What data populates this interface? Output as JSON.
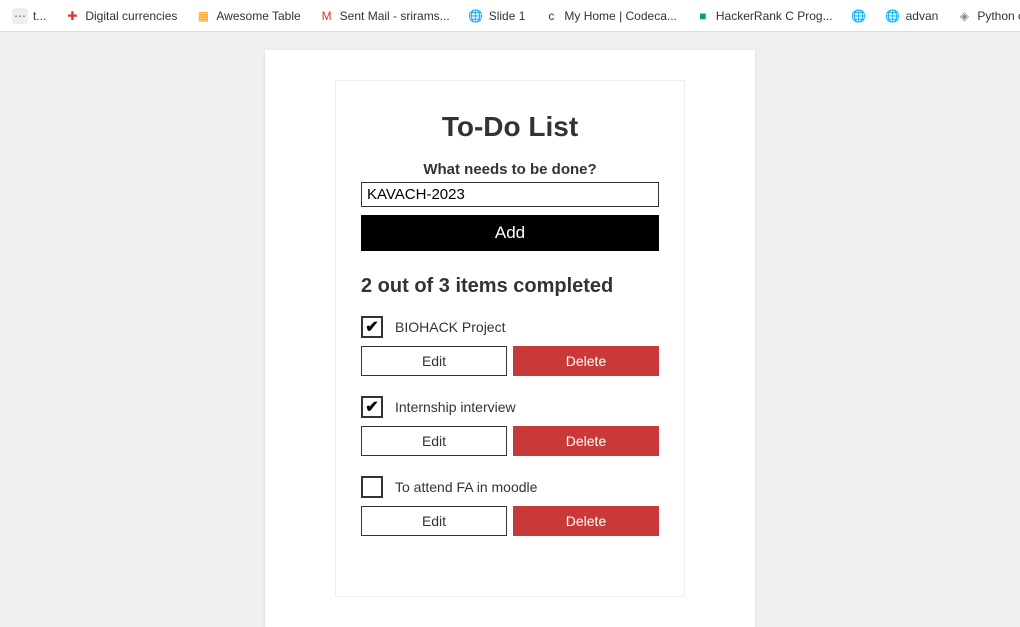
{
  "bookmarks": [
    {
      "label": "t...",
      "icon": "⋯",
      "iconBg": "#eee",
      "iconColor": "#666"
    },
    {
      "label": "Digital currencies",
      "icon": "✚",
      "iconColor": "#d33"
    },
    {
      "label": "Awesome Table",
      "icon": "▦",
      "iconColor": "#f90"
    },
    {
      "label": "Sent Mail - srirams...",
      "icon": "M",
      "iconColor": "#d33"
    },
    {
      "label": "Slide 1",
      "icon": "🌐",
      "iconColor": "#333"
    },
    {
      "label": "My Home | Codeca...",
      "icon": "c",
      "iconColor": "#336"
    },
    {
      "label": "HackerRank C Prog...",
      "icon": "■",
      "iconColor": "#0a6"
    },
    {
      "label": "",
      "icon": "🌐",
      "iconColor": "#333"
    },
    {
      "label": "advan",
      "icon": "🌐",
      "iconColor": "#333"
    },
    {
      "label": "Python object seria",
      "icon": "◈",
      "iconColor": "#888"
    }
  ],
  "app": {
    "title": "To-Do List",
    "prompt": "What needs to be done?",
    "input_value": "KAVACH-2023",
    "add_label": "Add",
    "summary": "2 out of 3 items completed",
    "edit_label": "Edit",
    "delete_label": "Delete",
    "items": [
      {
        "label": "BIOHACK Project",
        "checked": true
      },
      {
        "label": "Internship interview",
        "checked": true
      },
      {
        "label": "To attend FA in moodle",
        "checked": false
      }
    ]
  }
}
